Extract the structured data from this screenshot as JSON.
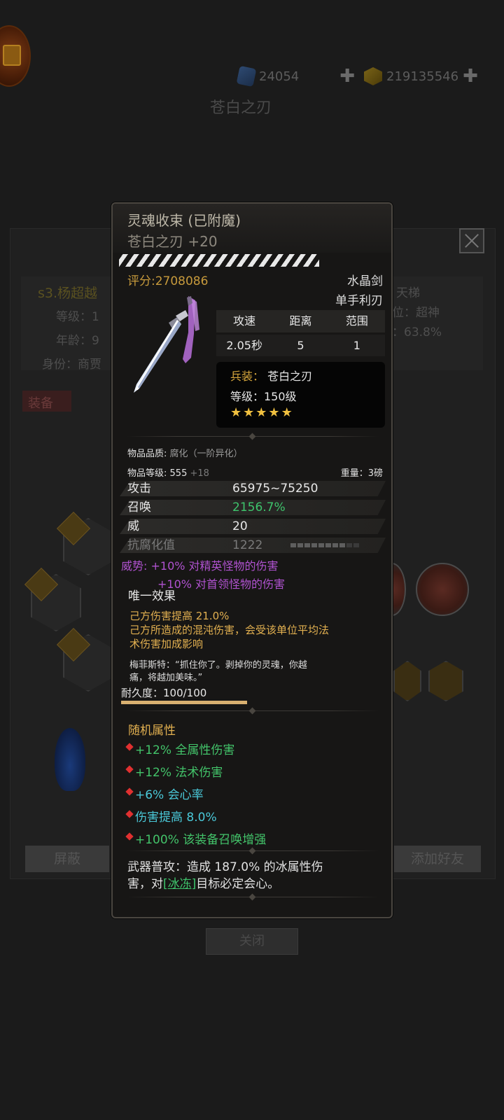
{
  "background": {
    "currency": {
      "gems": "24054",
      "gold": "219135546",
      "add_symbol": "✚"
    },
    "title": "苍白之刃",
    "player": {
      "name": "s3.杨超越",
      "level_label": "等级：1",
      "age_label": "年龄：9",
      "identity_label": "身份：商贾",
      "right_name": "天梯",
      "right_rank": "位：超神",
      "right_pct": "：63.8%"
    },
    "equip_tab": "装备",
    "buttons": {
      "block": "屏蔽",
      "add_friend": "添加好友",
      "close": "关闭"
    }
  },
  "tooltip": {
    "title": "灵魂收束 (已附魔)",
    "subtitle": "苍白之刃 +20",
    "score": "评分:2708086",
    "weapon_type": "水晶剑",
    "weapon_hand": "单手利刃",
    "stat_table": {
      "headers": [
        "攻速",
        "距离",
        "范围"
      ],
      "values": [
        "2.05秒",
        "5",
        "1"
      ]
    },
    "weapon_box": {
      "label_key": "兵装：",
      "label_value": "苍白之刃",
      "level": "等级：150级",
      "stars": 5
    },
    "quality_key": "物品品质:",
    "quality_value": "腐化（一阶异化）",
    "item_level_key": "物品等级:",
    "item_level_value": "555",
    "item_level_bonus": "+18",
    "weight": "重量：3磅",
    "attributes": [
      {
        "name": "攻击",
        "value": "65975~75250"
      },
      {
        "name": "召唤",
        "value": "2156.7%"
      },
      {
        "name": "威",
        "value": "20"
      },
      {
        "name": "抗腐化值",
        "value": "1222"
      }
    ],
    "corruption_bar": {
      "filled": 8,
      "total": 10
    },
    "prestige": [
      "威势: +10% 对精英怪物的伤害",
      "+10% 对首领怪物的伤害"
    ],
    "unique_title": "唯一效果",
    "unique_effects": [
      "己方伤害提高 21.0%",
      "己方所造成的混沌伤害，会受该单位平均法",
      "术伤害加成影响"
    ],
    "quote": [
      "梅菲斯特：“抓住你了。剥掉你的灵魂，你越",
      "痛，将越加美味。”"
    ],
    "durability": "耐久度：100/100",
    "durability_pct": 1.0,
    "random_title": "随机属性",
    "random_attrs": [
      {
        "text": "+12% 全属性伤害",
        "color": "green"
      },
      {
        "text": "+12% 法术伤害",
        "color": "green"
      },
      {
        "text": "+6% 会心率",
        "color": "cyan"
      },
      {
        "text": "伤害提高 8.0%",
        "color": "cyan"
      },
      {
        "text": "+100% 该装备召唤增强",
        "color": "green"
      }
    ],
    "attack_desc_1": "武器普攻：造成 187.0% 的冰属性伤",
    "attack_desc_2a": "害，对",
    "attack_desc_hl": "[冰冻]",
    "attack_desc_2b": "目标必定会心。"
  },
  "colors": {
    "gold": "#c79a3c",
    "green": "#3ec46c",
    "purple": "#b052d0",
    "orange": "#e2b050",
    "cyan": "#4ac8d8"
  }
}
